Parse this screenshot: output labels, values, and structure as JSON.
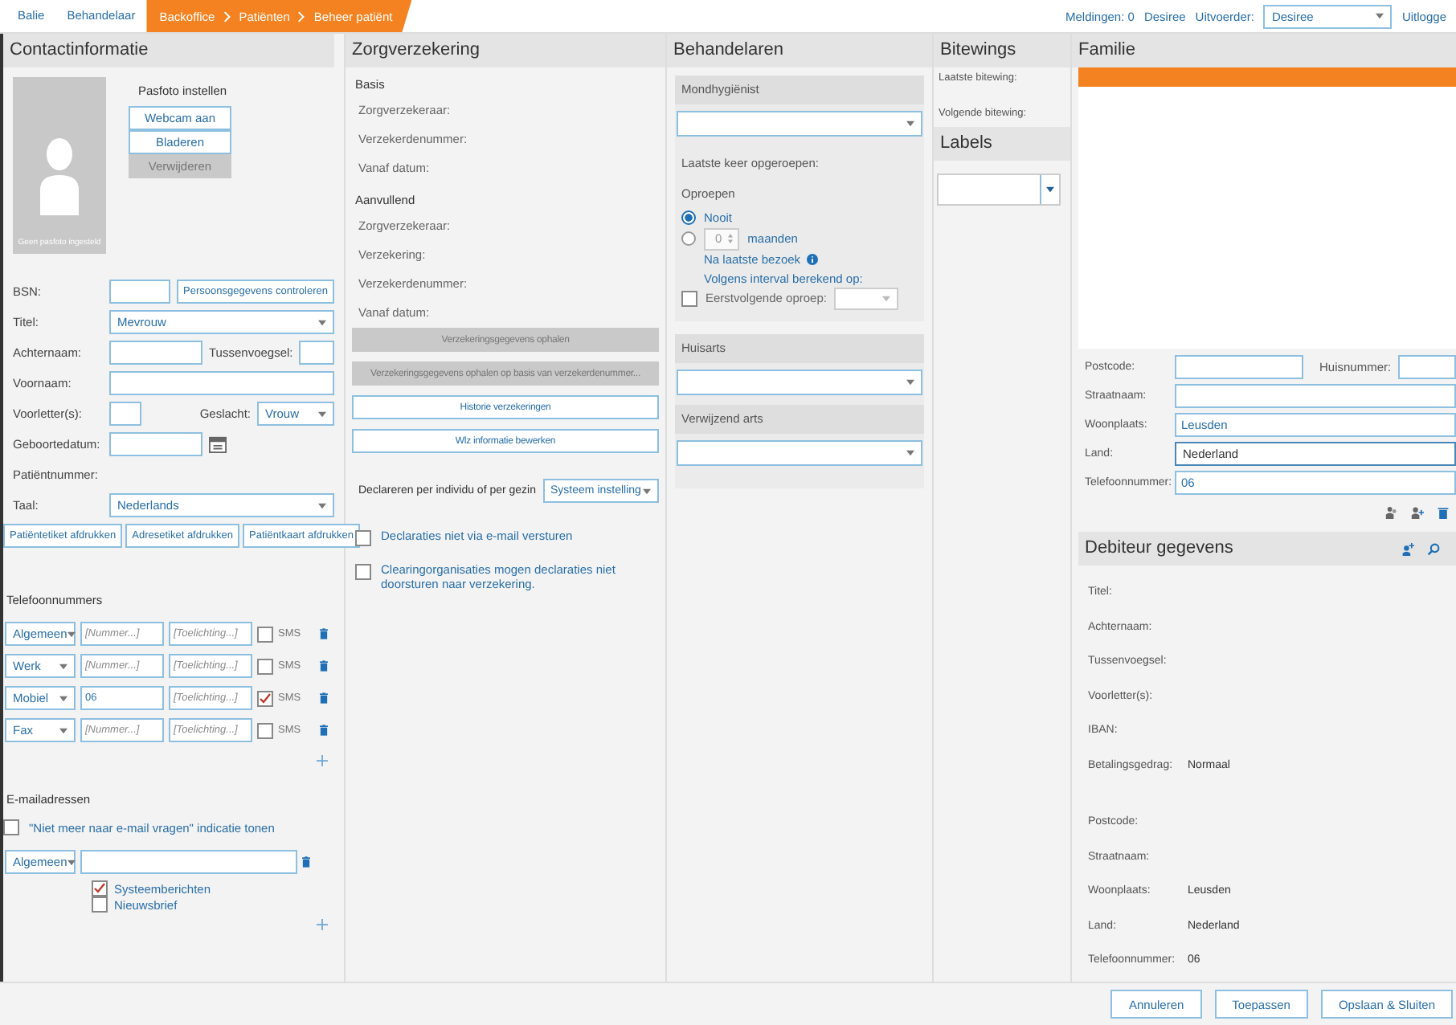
{
  "top_bar": {
    "tabs": [
      {
        "label": "Balie",
        "selected": false
      },
      {
        "label": "Behandelaar",
        "selected": false
      }
    ],
    "breadcrumb": [
      "Backoffice",
      "Patiënten",
      "Beheer patiënt"
    ],
    "notifications": "Meldingen: 0",
    "user": "Desiree",
    "executor_label": "Uitvoerder:",
    "executor": "Desiree",
    "logout": "Uitlogge"
  },
  "contact": {
    "title": "Contactinformatie",
    "photo_caption": "Geen pasfoto ingesteld",
    "photo_heading": "Pasfoto instellen",
    "photo_buttons": [
      {
        "label": "Webcam aan",
        "disabled": false
      },
      {
        "label": "Bladeren",
        "disabled": false
      },
      {
        "label": "Verwijderen",
        "disabled": true
      }
    ],
    "bsn_label": "BSN:",
    "check_button": "Persoonsgegevens controleren",
    "title_label": "Titel:",
    "title_value": "Mevrouw",
    "surname_label": "Achternaam:",
    "infix_label": "Tussenvoegsel:",
    "firstname_label": "Voornaam:",
    "initials_label": "Voorletter(s):",
    "gender_label": "Geslacht:",
    "gender_value": "Vrouw",
    "birthdate_label": "Geboortedatum:",
    "patient_number_label": "Patiëntnummer:",
    "language_label": "Taal:",
    "language_value": "Nederlands",
    "print_buttons": [
      "Patiëntetiket afdrukken",
      "Adresetiket afdrukken",
      "Patiëntkaart afdrukken"
    ]
  },
  "phones": {
    "title": "Telefoonnummers",
    "rows": [
      {
        "type": "Algemeen",
        "placeholder": "[Nummer...]",
        "note_placeholder": "[Toelichting...]",
        "sms_label": "SMS",
        "sms": false
      },
      {
        "type": "Werk",
        "placeholder": "[Nummer...]",
        "note_placeholder": "[Toelichting...]",
        "sms_label": "SMS",
        "sms": false
      },
      {
        "type": "Mobiel",
        "number": "06",
        "note_placeholder": "[Toelichting...]",
        "sms_label": "SMS",
        "sms": true
      },
      {
        "type": "Fax",
        "placeholder": "[Nummer...]",
        "note_placeholder": "[Toelichting...]",
        "sms_label": "SMS",
        "sms": false
      }
    ]
  },
  "emails": {
    "title": "E-mailadressen",
    "ask_checkbox": {
      "label": "\"Niet meer naar e-mail vragen\" indicatie tonen",
      "checked": false
    },
    "rows": [
      {
        "type": "Algemeen",
        "subscriptions": [
          {
            "label": "Systeemberichten",
            "checked": true
          },
          {
            "label": "Nieuwsbrief",
            "checked": false
          }
        ]
      }
    ]
  },
  "insurance": {
    "title": "Zorgverzekering",
    "sections": [
      {
        "heading": "Basis",
        "fields": [
          "Zorgverzekeraar:",
          "Verzekerdenummer:",
          "Vanaf datum:"
        ]
      },
      {
        "heading": "Aanvullend",
        "fields": [
          "Zorgverzekeraar:",
          "Verzekering:",
          "Verzekerdenummer:",
          "Vanaf datum:"
        ]
      }
    ],
    "buttons": [
      {
        "label": "Verzekeringsgegevens ophalen",
        "disabled": true
      },
      {
        "label": "Verzekeringsgegevens ophalen op basis van verzekerdenummer...",
        "disabled": true
      },
      {
        "label": "Historie verzekeringen",
        "disabled": false
      },
      {
        "label": "Wlz informatie bewerken",
        "disabled": false
      }
    ],
    "declare_label": "Declareren per individu of per gezin",
    "declare_value": "Systeem instelling",
    "checkboxes": [
      {
        "label": "Declaraties niet via e-mail versturen",
        "checked": false
      },
      {
        "label": "Clearingorganisaties mogen declaraties niet doorsturen naar verzekering.",
        "checked": false
      }
    ]
  },
  "practitioners": {
    "title": "Behandelaren",
    "hygienist_heading": "Mondhygiënist",
    "last_recall_label": "Laatste keer opgeroepen:",
    "recall_label": "Oproepen",
    "recall_options": [
      {
        "kind": "label",
        "label": "Nooit",
        "selected": true
      },
      {
        "kind": "interval",
        "value": "0",
        "unit": "maanden",
        "selected": false
      }
    ],
    "after_visit": "Na laatste bezoek",
    "interval_based": "Volgens interval berekend op:",
    "next_recall": {
      "label": "Eerstvolgende oproep:",
      "checked": false
    },
    "gp_heading": "Huisarts",
    "referrer_heading": "Verwijzend arts"
  },
  "bitewings": {
    "title": "Bitewings",
    "last": "Laatste bitewing:",
    "next": "Volgende bitewing:",
    "labels_title": "Labels"
  },
  "family": {
    "title": "Familie",
    "members": [
      {
        "selected": true
      }
    ],
    "address": {
      "postcode_label": "Postcode:",
      "house_number_label": "Huisnummer:",
      "street_label": "Straatnaam:",
      "city_label": "Woonplaats:",
      "city": "Leusden",
      "country_label": "Land:",
      "country": "Nederland",
      "phone_label": "Telefoonnummer:",
      "phone": "06"
    }
  },
  "debtor": {
    "title": "Debiteur gegevens",
    "groups": [
      [
        {
          "label": "Titel:"
        },
        {
          "label": "Achternaam:"
        },
        {
          "label": "Tussenvoegsel:"
        },
        {
          "label": "Voorletter(s):"
        },
        {
          "label": "IBAN:"
        },
        {
          "label": "Betalingsgedrag:",
          "value": "Normaal"
        }
      ],
      [
        {
          "label": "Postcode:"
        },
        {
          "label": "Straatnaam:"
        },
        {
          "label": "Woonplaats:",
          "value": "Leusden"
        },
        {
          "label": "Land:",
          "value": "Nederland"
        },
        {
          "label": "Telefoonnummer:",
          "value": "06"
        }
      ]
    ]
  },
  "footer_buttons": [
    "Annuleren",
    "Toepassen",
    "Opslaan & Sluiten"
  ]
}
